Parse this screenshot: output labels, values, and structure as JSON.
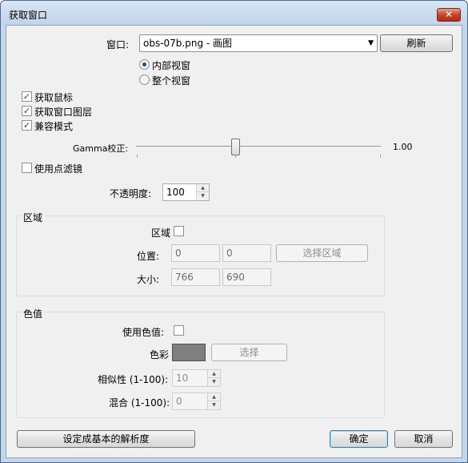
{
  "window": {
    "title": "获取窗口",
    "close_label": "✕"
  },
  "window_select": {
    "label": "窗口:",
    "value": "obs-07b.png - 画图",
    "refresh_label": "刷新"
  },
  "capture_mode": [
    {
      "label": "内部视窗",
      "checked": true
    },
    {
      "label": "整个视窗",
      "checked": false
    }
  ],
  "options": [
    {
      "label": "获取鼠标",
      "checked": true
    },
    {
      "label": "获取窗口图层",
      "checked": true
    },
    {
      "label": "兼容模式",
      "checked": true
    }
  ],
  "gamma": {
    "label": "Gamma校正:",
    "value": "1.00",
    "level": 0.5
  },
  "point_filter": {
    "label": "使用点滤镜",
    "checked": false
  },
  "opacity": {
    "label": "不透明度:",
    "value": "100"
  },
  "region": {
    "group_title": "区域",
    "enable_label": "区域",
    "position_label": "位置:",
    "pos_x": "0",
    "pos_y": "0",
    "select_region_label": "选择区域",
    "size_label": "大小:",
    "size_w": "766",
    "size_h": "690"
  },
  "color_key": {
    "group_title": "色值",
    "use_label": "使用色值:",
    "color_label": "色彩",
    "color_hex": "#7f7f7f",
    "select_label": "选择",
    "similarity_label": "相似性 (1-100):",
    "similarity_value": "10",
    "blend_label": "混合 (1-100):",
    "blend_value": "0"
  },
  "footer": {
    "base_res_label": "设定成基本的解析度",
    "ok_label": "确定",
    "cancel_label": "取消"
  }
}
